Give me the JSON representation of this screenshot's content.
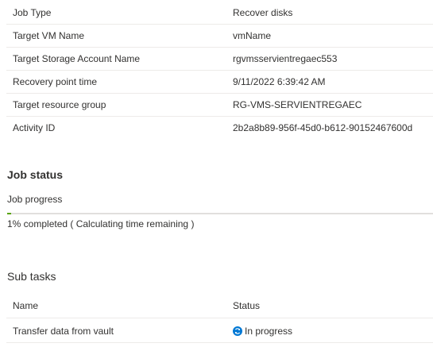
{
  "details": [
    {
      "key": "Job Type",
      "value": "Recover disks"
    },
    {
      "key": "Target VM Name",
      "value": "vmName"
    },
    {
      "key": "Target Storage Account Name",
      "value": "rgvmsservientregaec553"
    },
    {
      "key": "Recovery point time",
      "value": "9/11/2022 6:39:42 AM"
    },
    {
      "key": "Target resource group",
      "value": "RG-VMS-SERVIENTREGAEC"
    },
    {
      "key": "Activity ID",
      "value": "2b2a8b89-956f-45d0-b612-90152467600d"
    }
  ],
  "job_status": {
    "title": "Job status",
    "progress_label": "Job progress",
    "progress_percent": 1,
    "progress_text": "1% completed ( Calculating time remaining )",
    "progress_color": "#57a300"
  },
  "sub_tasks": {
    "title": "Sub tasks",
    "columns": {
      "name": "Name",
      "status": "Status"
    },
    "rows": [
      {
        "name": "Transfer data from vault",
        "status": "In progress",
        "status_icon": "refresh-icon"
      }
    ]
  }
}
